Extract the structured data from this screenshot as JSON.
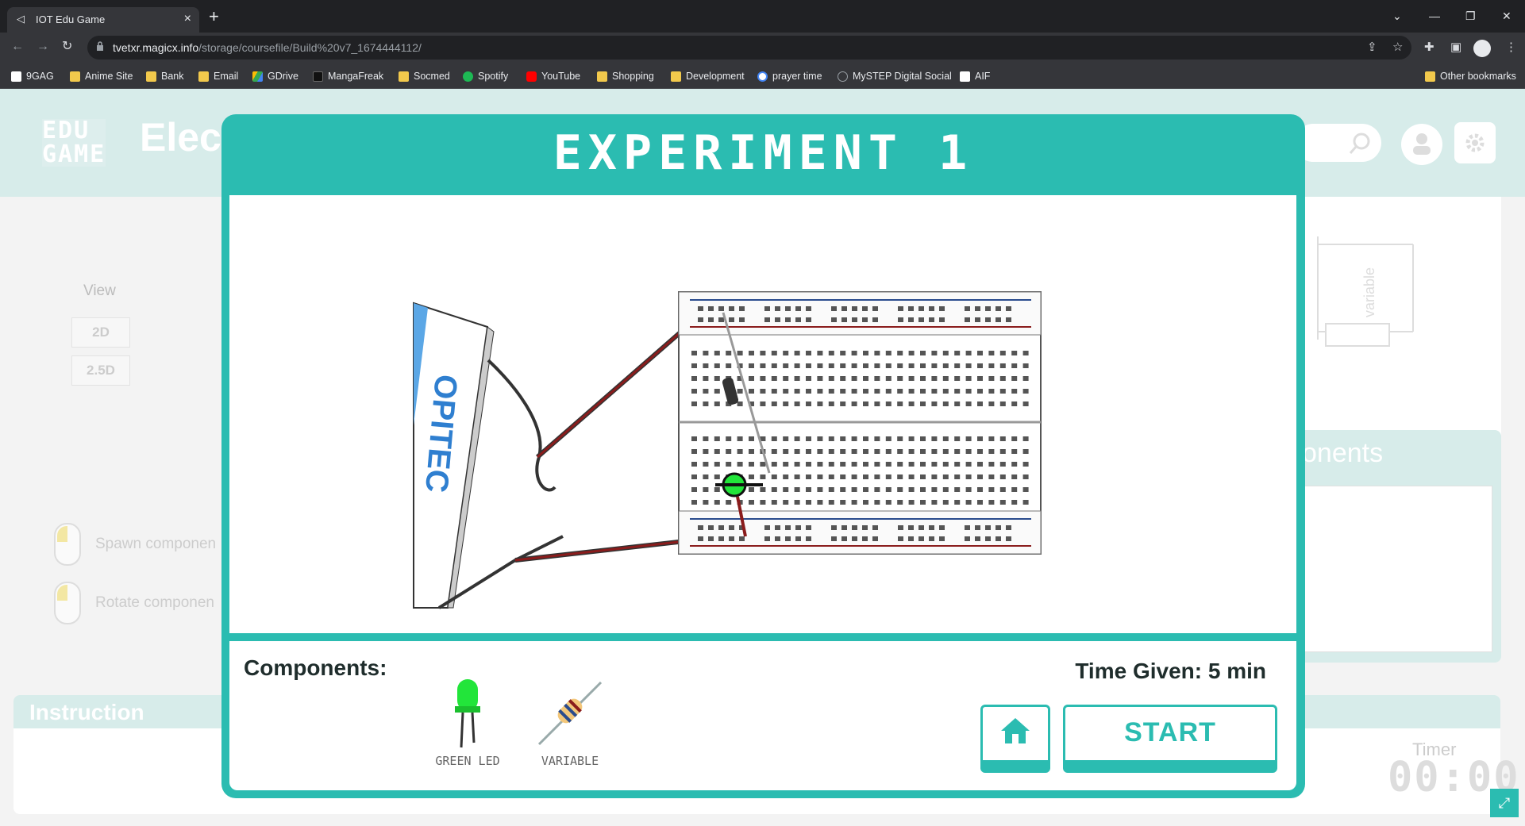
{
  "browser": {
    "tab_title": "IOT Edu Game",
    "url_host": "tvetxr.magicx.info",
    "url_path": "/storage/coursefile/Build%20v7_1674444112/",
    "bookmarks": [
      "9GAG",
      "Anime Site",
      "Bank",
      "Email",
      "GDrive",
      "MangaFreak",
      "Socmed",
      "Spotify",
      "YouTube",
      "Shopping",
      "Development",
      "prayer time",
      "MySTEP Digital Social",
      "AIF"
    ],
    "other_bookmarks": "Other bookmarks"
  },
  "game": {
    "logo_line1": "EDU",
    "logo_line2": "GAME",
    "logo_text": "Elec",
    "view_label": "View",
    "view_options": [
      "2D",
      "2.5D"
    ],
    "hints": [
      "Spawn componen",
      "Rotate componen"
    ],
    "components_title": "onents",
    "instruction_title": "Instruction",
    "timer_label": "Timer",
    "timer_value": "00:00",
    "schematic_label": "variable"
  },
  "modal": {
    "title": "EXPERIMENT 1",
    "components_label": "Components:",
    "components": [
      {
        "name": "GREEN LED",
        "icon": "green-led-icon"
      },
      {
        "name": "VARIABLE",
        "icon": "resistor-icon"
      }
    ],
    "time_given": "Time Given: 5 min",
    "start_label": "START",
    "board_brand": "OPITEC"
  },
  "colors": {
    "accent": "#2bbcb1",
    "header_bg": "#d7ecea",
    "led_green": "#22e53a",
    "wire_red": "#8a1c1c"
  }
}
